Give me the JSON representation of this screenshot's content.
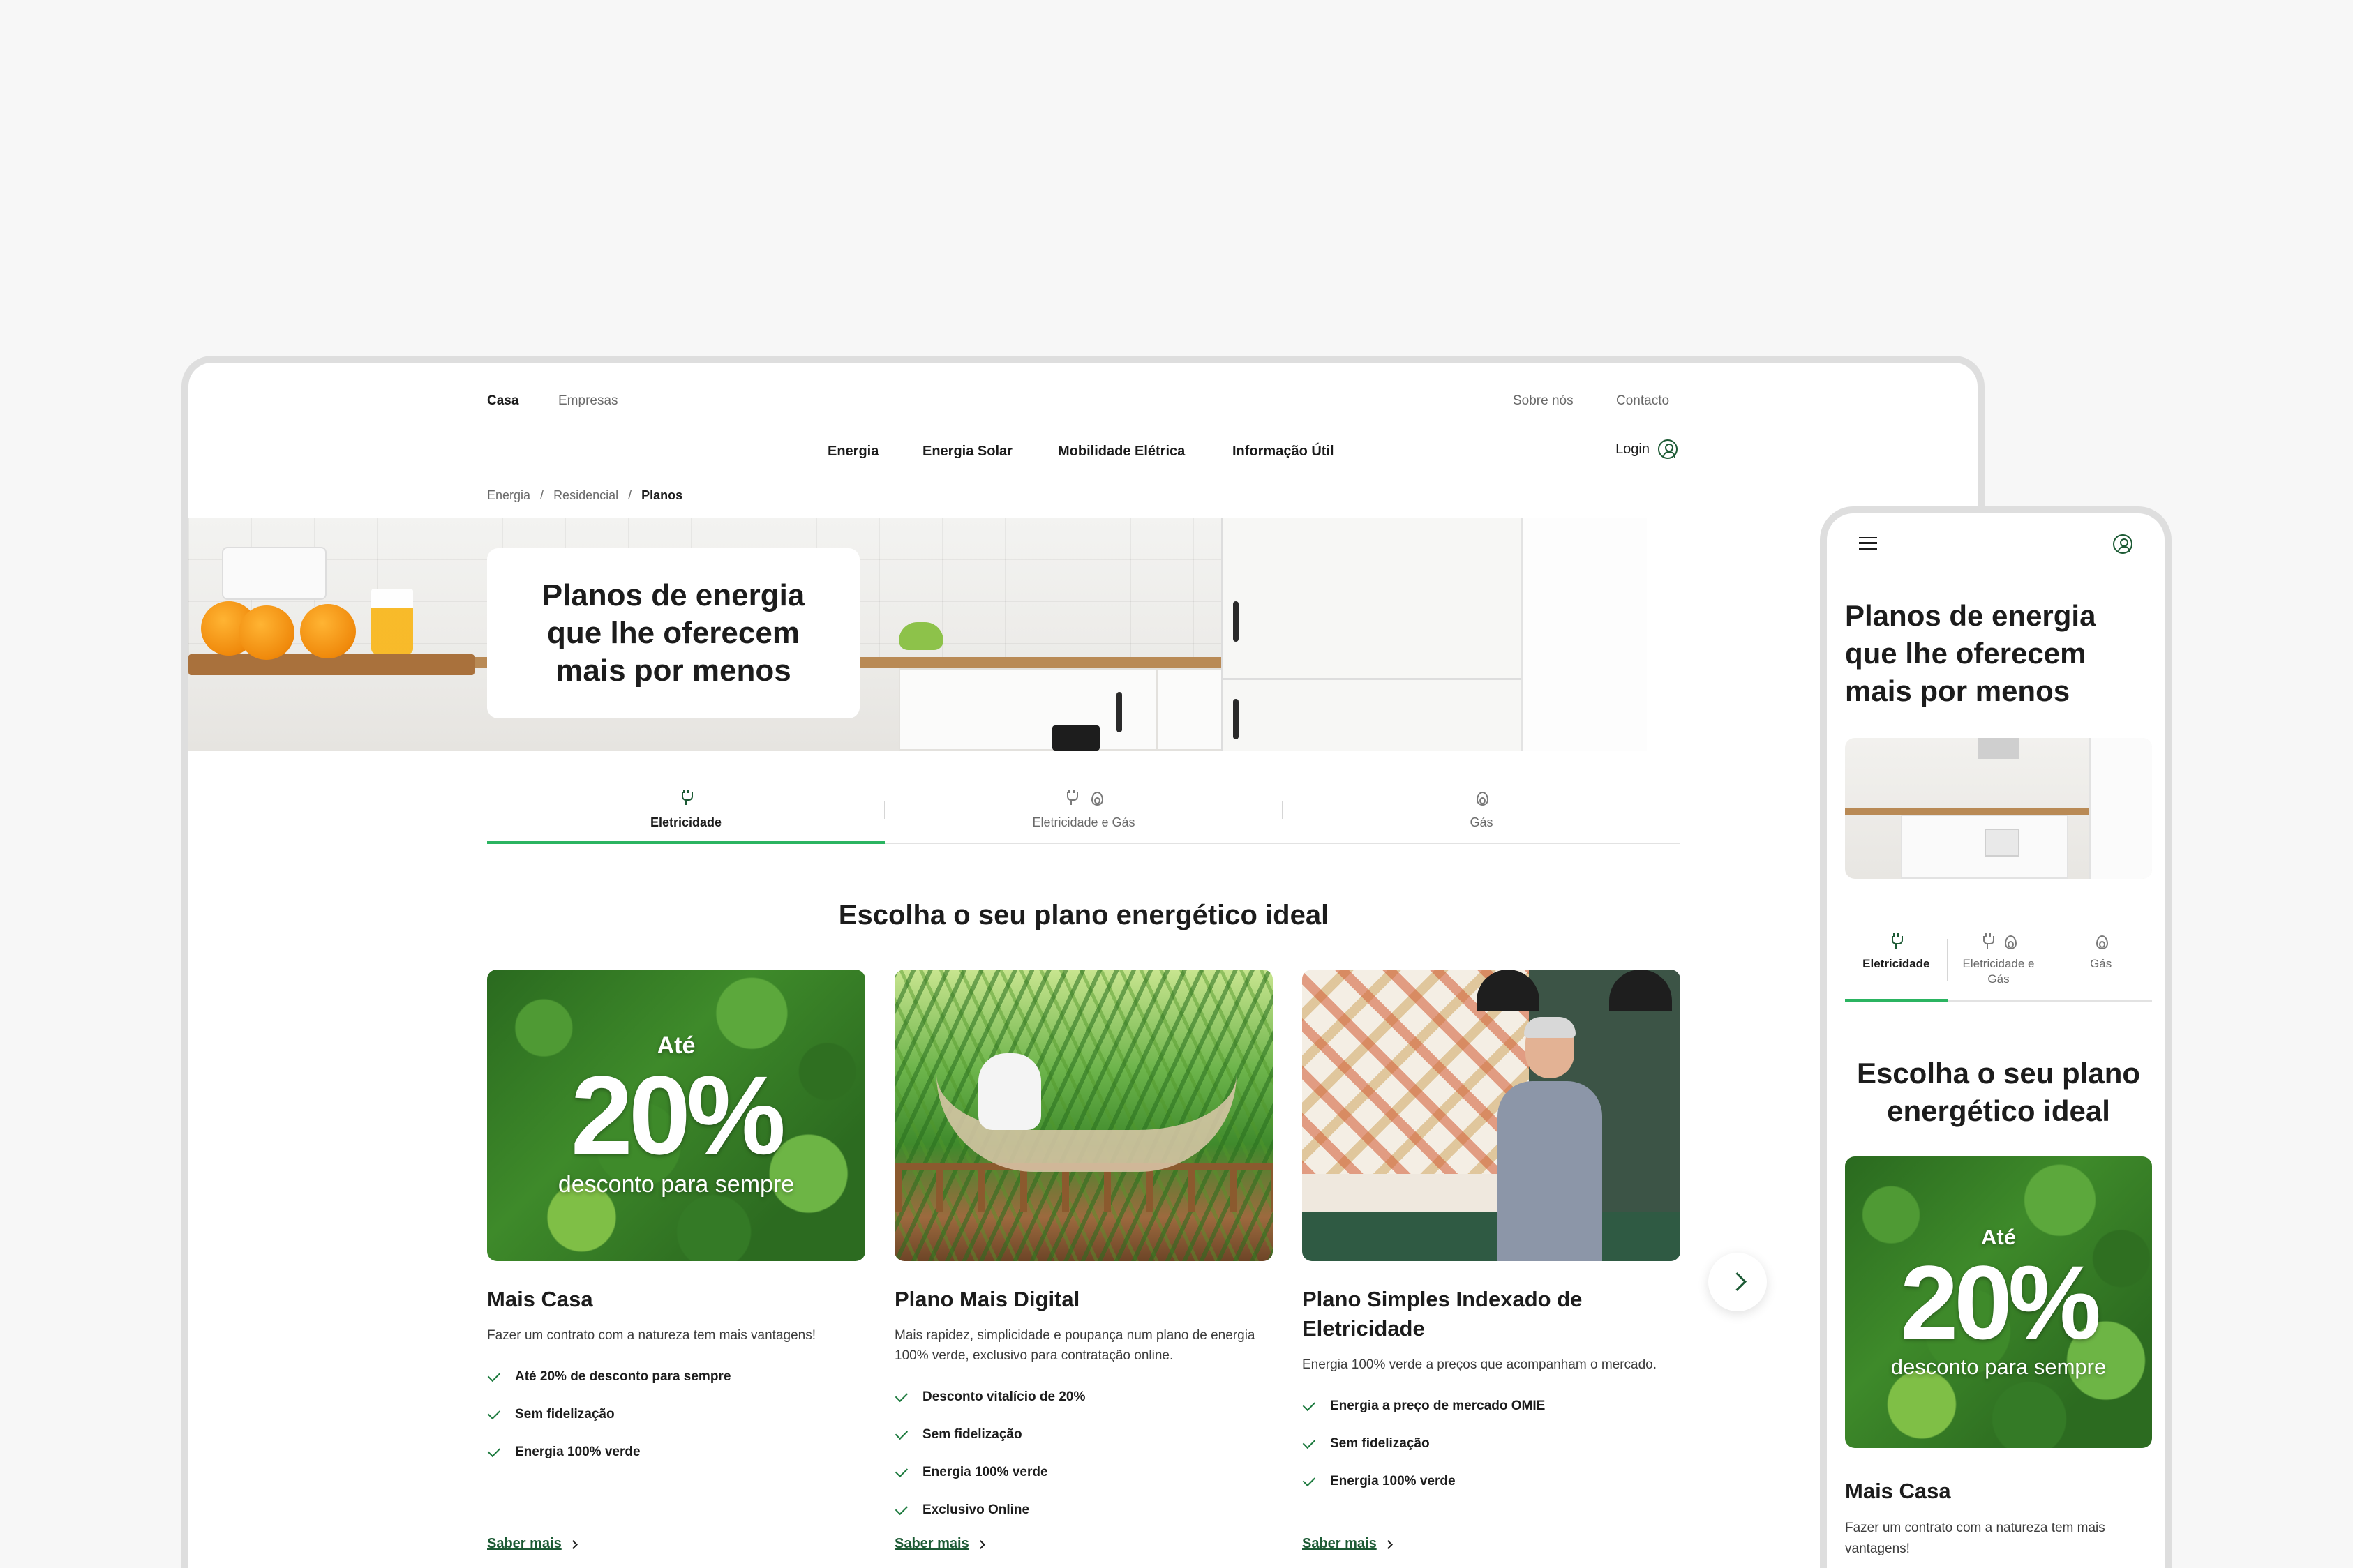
{
  "desktop": {
    "topbar": {
      "segments": [
        "Casa",
        "Empresas"
      ],
      "links": [
        "Sobre nós",
        "Contacto"
      ]
    },
    "nav": {
      "items": [
        "Energia",
        "Energia Solar",
        "Mobilidade Elétrica",
        "Informação Útil"
      ],
      "login": "Login"
    },
    "breadcrumb": [
      "Energia",
      "Residencial",
      "Planos"
    ],
    "hero": {
      "title": "Planos de energia que lhe oferecem mais por menos"
    },
    "tabs": [
      {
        "label": "Eletricidade",
        "icons": [
          "plug-icon"
        ],
        "active": true
      },
      {
        "label": "Eletricidade e Gás",
        "icons": [
          "plug-icon",
          "flame-icon"
        ],
        "active": false
      },
      {
        "label": "Gás",
        "icons": [
          "flame-icon"
        ],
        "active": false
      }
    ],
    "section_title": "Escolha o seu plano energético ideal",
    "promo": {
      "ate": "Até",
      "pct": "20%",
      "sub": "desconto para sempre"
    },
    "cards": [
      {
        "title": "Mais Casa",
        "desc": "Fazer um contrato com a natureza tem mais vantagens!",
        "features": [
          "Até 20% de desconto para sempre",
          "Sem fidelização",
          "Energia 100% verde"
        ],
        "link": "Saber mais"
      },
      {
        "title": "Plano Mais Digital",
        "desc": "Mais rapidez, simplicidade e poupança num plano de energia 100% verde, exclusivo para contratação online.",
        "features": [
          "Desconto vitalício de 20%",
          "Sem fidelização",
          "Energia 100% verde",
          "Exclusivo Online"
        ],
        "link": "Saber mais"
      },
      {
        "title": "Plano Simples Indexado de Eletricidade",
        "desc": "Energia 100% verde a preços que acompanham o mercado.",
        "features": [
          "Energia a preço de mercado OMIE",
          "Sem fidelização",
          "Energia 100% verde"
        ],
        "link": "Saber mais"
      }
    ]
  },
  "mobile": {
    "hero_title": "Planos de energia que lhe oferecem mais por menos",
    "tabs": [
      {
        "label": "Eletricidade",
        "active": true
      },
      {
        "label": "Eletricidade e Gás",
        "active": false
      },
      {
        "label": "Gás",
        "active": false
      }
    ],
    "section_title": "Escolha o seu plano energético ideal",
    "promo": {
      "ate": "Até",
      "pct": "20%",
      "sub": "desconto para sempre"
    },
    "card": {
      "title": "Mais Casa",
      "desc": "Fazer um contrato com a natureza tem mais vantagens!"
    }
  },
  "colors": {
    "accent_green": "#2bb461",
    "dark_green": "#1c5a34",
    "text": "#1c1c1c",
    "background": "#f7f7f7"
  }
}
